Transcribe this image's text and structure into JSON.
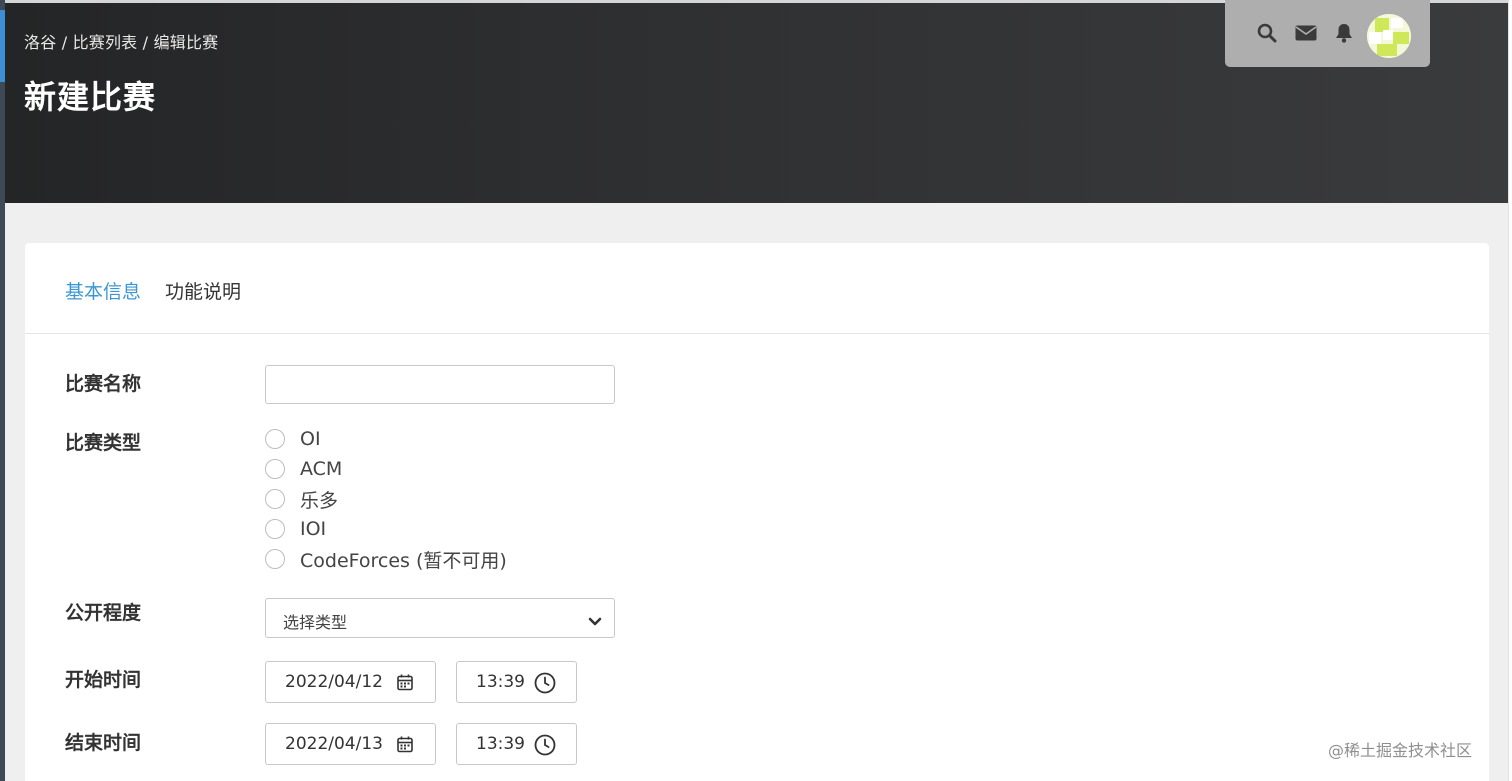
{
  "header": {
    "breadcrumb": [
      "洛谷",
      "比赛列表",
      "编辑比赛"
    ],
    "breadcrumb_sep": " / ",
    "title": "新建比赛"
  },
  "userbar": {
    "icons": [
      "search-icon",
      "mail-icon",
      "bell-icon"
    ],
    "avatar": "avatar"
  },
  "tabs": [
    {
      "label": "基本信息",
      "active": true
    },
    {
      "label": "功能说明",
      "active": false
    }
  ],
  "form": {
    "name": {
      "label": "比赛名称",
      "value": ""
    },
    "type": {
      "label": "比赛类型",
      "options": [
        "OI",
        "ACM",
        "乐多",
        "IOI",
        "CodeForces (暂不可用)"
      ]
    },
    "visibility": {
      "label": "公开程度",
      "selected": "选择类型"
    },
    "start": {
      "label": "开始时间",
      "date": "2022/04/12",
      "time": "13:39"
    },
    "end": {
      "label": "结束时间",
      "date": "2022/04/13",
      "time": "13:39"
    }
  },
  "watermark": "@稀土掘金技术社区",
  "colors": {
    "accent": "#3b97d3",
    "header_dark": "#242526",
    "userbar_bg": "#aeaeae"
  }
}
